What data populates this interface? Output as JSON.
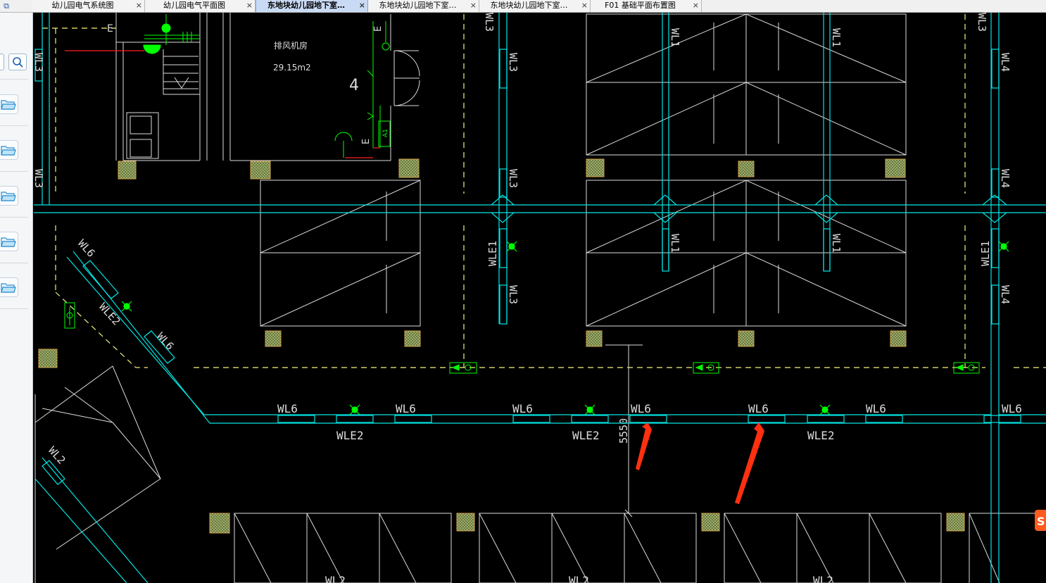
{
  "tabs": [
    {
      "label": "幼儿园电气系统图",
      "active": false
    },
    {
      "label": "幼儿园电气平面图",
      "active": false
    },
    {
      "label": "东地块幼儿园地下室…",
      "active": true
    },
    {
      "label": "东地块幼儿园地下室…",
      "active": false
    },
    {
      "label": "东地块幼儿园地下室…",
      "active": false
    },
    {
      "label": "F01 基础平面布置图",
      "active": false
    }
  ],
  "tab_close_glyph": "×",
  "window_restore_glyph": "⧉",
  "sidebar": {
    "icons": [
      "collapse-panel-icon",
      "search-icon",
      "folder-icon",
      "folder-icon",
      "folder-icon",
      "folder-icon",
      "folder-icon"
    ]
  },
  "drawing": {
    "room_name": "排风机房",
    "room_area": "29.15m2",
    "room_number": "4",
    "dimension": "5550",
    "wl6": "WL6",
    "wle2": "WLE2",
    "wl1": "WL1",
    "wl2": "WL2",
    "wl3": "WL3",
    "wl4": "WL4",
    "wle1": "WLE1",
    "e": "E",
    "a1": "A1"
  },
  "colors": {
    "background": "#000000",
    "conduit": "#00e5e5",
    "equipment": "#00ff00",
    "building": "#dcdcdc",
    "wiring": "#ff2020",
    "dashed": "#f5f57a",
    "annotation_arrow": "#ff3010"
  }
}
